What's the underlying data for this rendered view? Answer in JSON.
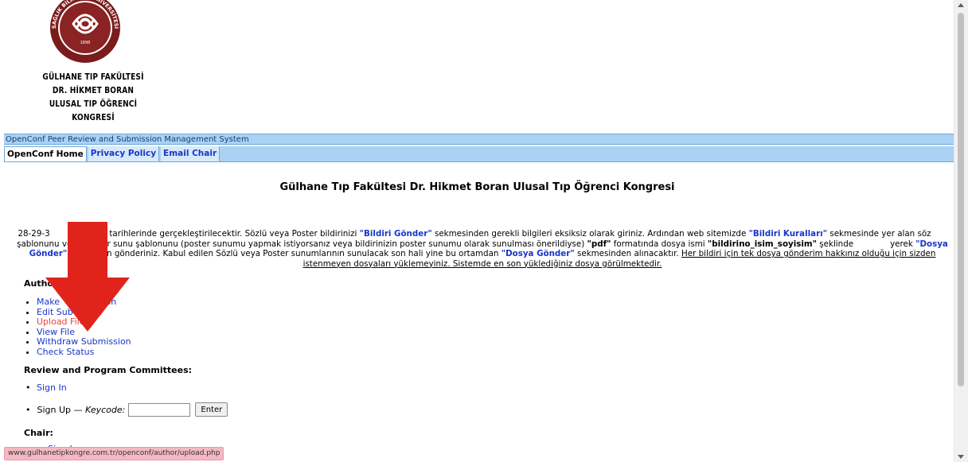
{
  "header": {
    "logo_ring_text": "SAĞLIK BİLİMLERİ ÜNİVERSİTESİ",
    "logo_inner_text": "GÜLHANE TIP FAKÜLTESİ",
    "logo_year": "1898",
    "lines": [
      "GÜLHANE TIP FAKÜLTESİ",
      "DR. HİKMET BORAN",
      "ULUSAL TIP ÖĞRENCİ KONGRESİ"
    ]
  },
  "system_bar": "OpenConf Peer Review and Submission Management System",
  "nav": [
    {
      "label": "OpenConf Home"
    },
    {
      "label": "Privacy Policy"
    },
    {
      "label": "Email Chair"
    }
  ],
  "title": "Gülhane Tıp Fakültesi Dr. Hikmet Boran Ulusal Tıp Öğrenci Kongresi",
  "intro": {
    "p1": "28-29-3",
    "p2": " 2023 tarihlerinde gerçekleştirilecektir. Sözlü veya Poster bildirinizi ",
    "q1": "\"Bildiri Gönder\"",
    "p3": " sekmesinden gerekli bilgileri eksiksiz olarak giriniz. Ardından web sitemizde ",
    "q2": "\"Bildiri Kuralları\"",
    "p4": " sekmesinde yer alan söz",
    "p5": " şablonunu veya poster sunu şablonunu (poster sunumu yapmak istiyorsanız veya bildirinizin poster sunumu olarak sunulması önerildiyse) ",
    "q3": "\"pdf\"",
    "p6": " formatında dosya ismi ",
    "q4": "\"bildirino_isim_soyisim\"",
    "p7": " şeklinde",
    "p8": "yerek ",
    "q5": "\"Dosya Gönder\"",
    "p9": " kısmından gönderiniz. Kabul edilen Sözlü veya Poster sunumlarının sunulacak son hali yine bu ortamdan ",
    "q6": "\"Dosya Gönder\"",
    "p10": " sekmesinden alınacaktır. ",
    "u1": "Her bildiri için tek dosya gönderim hakkınız olduğu için sizden istenmeyen dosyaları yüklemeyiniz. Sistemde en son yüklediğiniz dosya görülmektedir."
  },
  "authors": {
    "heading": "Autho",
    "links": [
      {
        "label": "Make",
        "tail": "ission"
      },
      {
        "label": "Edit Sub",
        "tail": "ission"
      },
      {
        "label": "Upload File",
        "tail": ""
      },
      {
        "label": "View File",
        "tail": ""
      },
      {
        "label": "Withdraw Submission",
        "tail": ""
      },
      {
        "label": "Check Status",
        "tail": ""
      }
    ]
  },
  "committees": {
    "heading": "Review and Program Committees:",
    "sign_in": "Sign In",
    "sign_up": "Sign Up — ",
    "keycode_label": "Keycode:",
    "keycode_value": "",
    "enter_label": "Enter"
  },
  "chair": {
    "heading": "Chair:",
    "partial": "Sign I"
  },
  "status_url": "www.gulhanetipkongre.com.tr/openconf/author/upload.php",
  "colors": {
    "link": "#1a35c8",
    "highlight": "#e8413b",
    "bar": "#a9d2f5",
    "arrow": "#e0241b"
  }
}
